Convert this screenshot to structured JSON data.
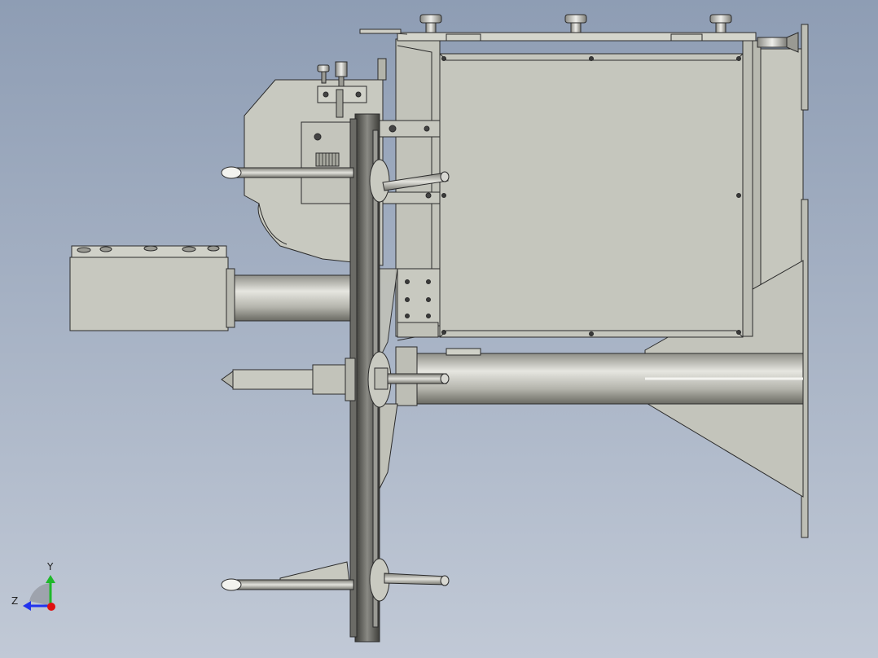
{
  "viewport": {
    "background_top": "#8e9db4",
    "background_bottom": "#c1c9d6"
  },
  "model_colors": {
    "body_fill": "#c9c9bf",
    "panel_fill": "#c4c5bc",
    "edge": "#2b2b2b",
    "metal_light": "#e8e8e2",
    "metal_dark": "#6e6e68",
    "disc": "#4a4a46"
  },
  "triad": {
    "y_label": "Y",
    "z_label": "Z",
    "y_color": "#1fb82a",
    "z_color": "#2233ee",
    "x_color": "#e01010"
  }
}
